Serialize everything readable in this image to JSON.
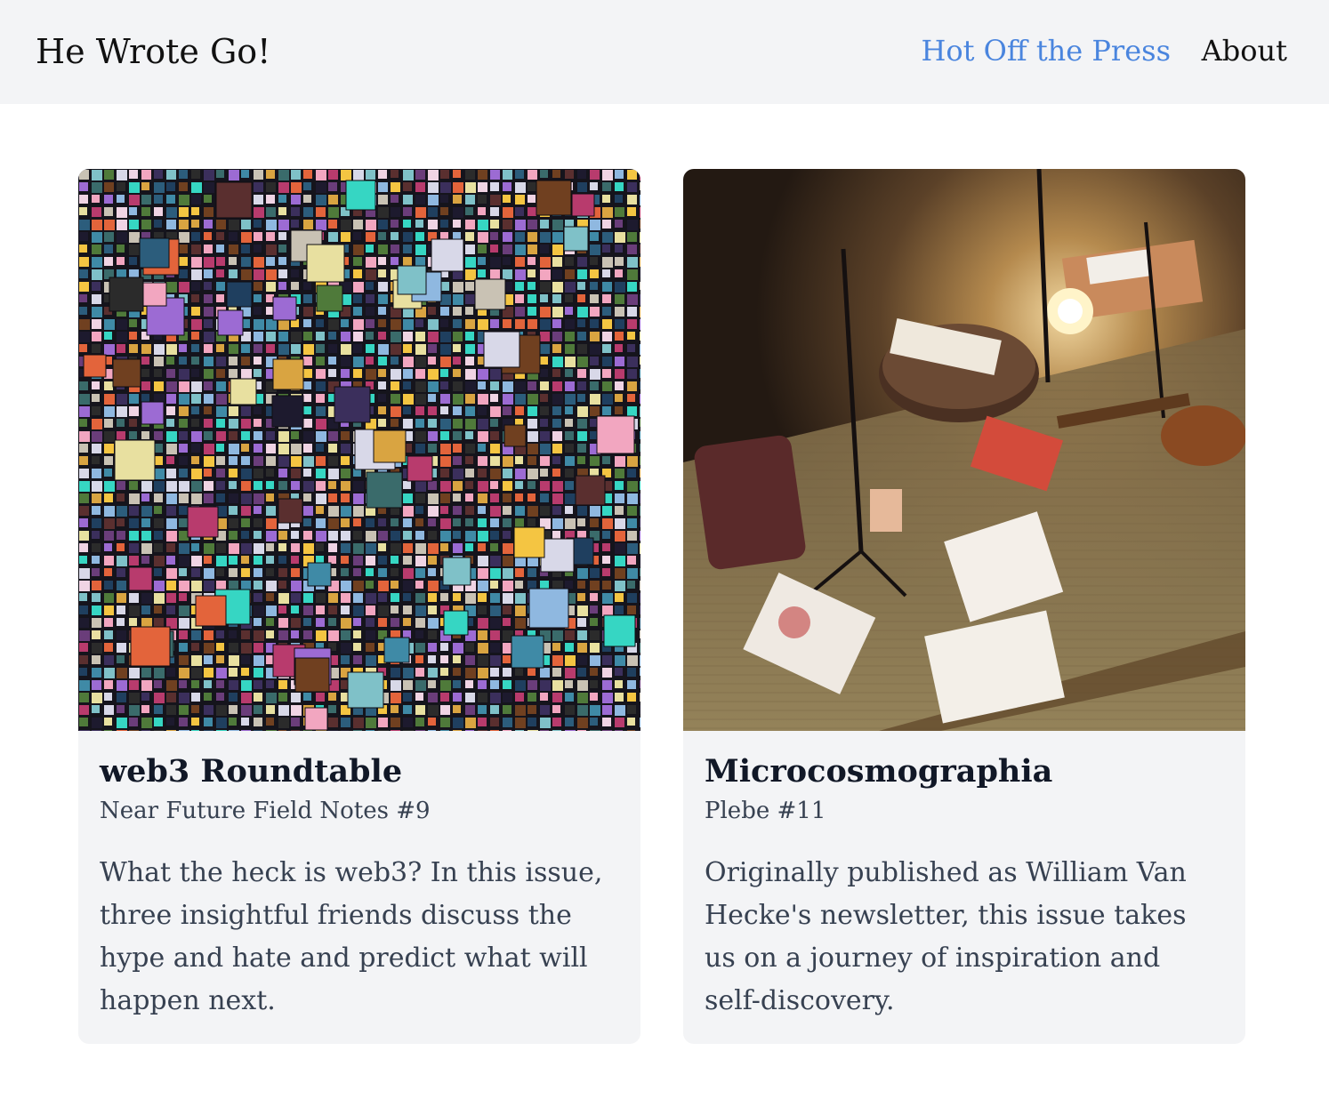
{
  "header": {
    "site_title": "He Wrote Go!",
    "nav": [
      {
        "label": "Hot Off the Press",
        "active": true
      },
      {
        "label": "About",
        "active": false
      }
    ],
    "colors": {
      "background": "#f3f4f6",
      "active_link": "#4a85de"
    }
  },
  "cards": [
    {
      "title": "web3 Roundtable",
      "subtitle": "Near Future Field Notes #9",
      "description": "What the heck is web3? In this issue, three insightful friends discuss the hype and hate and predict what will happen next.",
      "image": "digital-art-mosaic"
    },
    {
      "title": "Microcosmographia",
      "subtitle": "Plebe #11",
      "description": "Originally published as William Van Hecke's newsletter, this issue takes us on a journey of inspiration and self-discovery.",
      "image": "music-room-tatami-floor"
    }
  ]
}
